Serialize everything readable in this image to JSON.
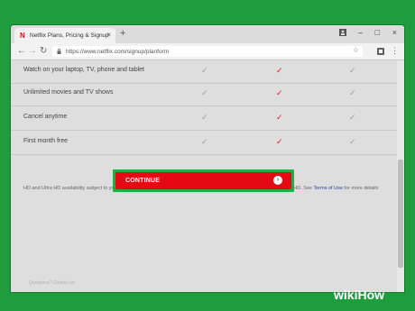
{
  "browser": {
    "tab_title": "Netflix Plans, Pricing & Signup",
    "tab_close": "×",
    "new_tab": "+",
    "url": "https://www.netflix.com/signup/planform",
    "minimize": "–",
    "maximize": "□",
    "close": "×"
  },
  "plan_table": {
    "rows": [
      {
        "label": "Watch on your laptop, TV, phone and tablet"
      },
      {
        "label": "Unlimited movies and TV shows"
      },
      {
        "label": "Cancel anytime"
      },
      {
        "label": "First month free"
      }
    ],
    "check_glyph": "✓"
  },
  "disclaimer": {
    "text": "HD and Ultra HD availability subject to your Internet service and device capabilities. Not all content available in HD or Ultra HD. See ",
    "link": "Terms of Use",
    "suffix": " for more details"
  },
  "cta": {
    "label": "CONTINUE",
    "arrow": "›"
  },
  "footer": {
    "text": "Questions? Contact us."
  },
  "watermark": {
    "wiki": "wiki",
    "how": "How"
  },
  "colors": {
    "background": "#1f9c3e",
    "netflix_red": "#e50914",
    "highlight_green": "#22ad42"
  }
}
